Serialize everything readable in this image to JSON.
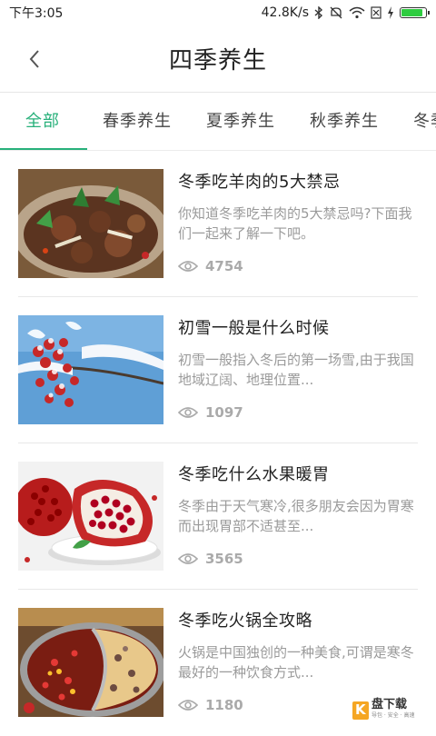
{
  "status_bar": {
    "time": "下午3:05",
    "network_speed": "42.8K/s",
    "battery_level": 0.95,
    "icons": [
      "bluetooth-icon",
      "mute-icon",
      "wifi-icon",
      "sim-icon",
      "charging-icon",
      "battery-icon"
    ]
  },
  "header": {
    "title": "四季养生",
    "back_icon": "chevron-left-icon"
  },
  "tabs": [
    {
      "label": "全部",
      "active": true
    },
    {
      "label": "春季养生",
      "active": false
    },
    {
      "label": "夏季养生",
      "active": false
    },
    {
      "label": "秋季养生",
      "active": false
    },
    {
      "label": "冬季养生",
      "active": false
    }
  ],
  "accent_color": "#27b07a",
  "articles": [
    {
      "title": "冬季吃羊肉的5大禁忌",
      "desc": "你知道冬季吃羊肉的5大禁忌吗?下面我们一起来了解一下吧。",
      "views": "4754",
      "thumb": "braised-lamb-dish-image"
    },
    {
      "title": "初雪一般是什么时候",
      "desc": "初雪一般指入冬后的第一场雪,由于我国地域辽阔、地理位置...",
      "views": "1097",
      "thumb": "snow-covered-red-berries-image"
    },
    {
      "title": "冬季吃什么水果暖胃",
      "desc": "冬季由于天气寒冷,很多朋友会因为胃寒而出现胃部不适甚至...",
      "views": "3565",
      "thumb": "pomegranate-image"
    },
    {
      "title": "冬季吃火锅全攻略",
      "desc": "火锅是中国独创的一种美食,可谓是寒冬最好的一种饮食方式...",
      "views": "1180",
      "thumb": "hot-pot-image"
    }
  ],
  "watermark": {
    "text": "盘下载",
    "logo_text": "K 快",
    "tagline": "导包 · 安全 · 高速"
  }
}
